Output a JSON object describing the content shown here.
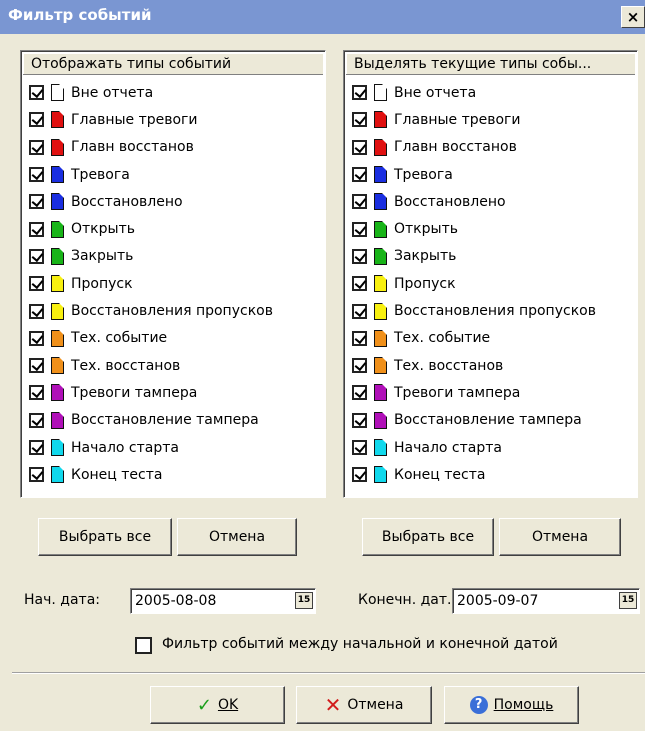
{
  "window": {
    "title": "Фильтр событий",
    "close_label": "×"
  },
  "left_list": {
    "header": "Отображать типы событий",
    "items": [
      {
        "label": "Вне отчета",
        "color": "#ffffff",
        "checked": true
      },
      {
        "label": "Главные тревоги",
        "color": "#e01010",
        "checked": true
      },
      {
        "label": "Главн восстанов",
        "color": "#e01010",
        "checked": true
      },
      {
        "label": "Тревога",
        "color": "#1a2ee0",
        "checked": true
      },
      {
        "label": "Восстановлено",
        "color": "#1a2ee0",
        "checked": true
      },
      {
        "label": "Открыть",
        "color": "#18b418",
        "checked": true
      },
      {
        "label": "Закрыть",
        "color": "#18b418",
        "checked": true
      },
      {
        "label": "Пропуск",
        "color": "#f8f010",
        "checked": true
      },
      {
        "label": "Восстановления пропусков",
        "color": "#f8f010",
        "checked": true
      },
      {
        "label": "Тех. событие",
        "color": "#f0901a",
        "checked": true
      },
      {
        "label": "Тех. восстанов",
        "color": "#f0901a",
        "checked": true
      },
      {
        "label": "Тревоги тампера",
        "color": "#b010b8",
        "checked": true
      },
      {
        "label": "Восстановление тампера",
        "color": "#b010b8",
        "checked": true
      },
      {
        "label": "Начало старта",
        "color": "#10d8ec",
        "checked": true
      },
      {
        "label": "Конец теста",
        "color": "#10d8ec",
        "checked": true
      }
    ],
    "select_all": "Выбрать все",
    "cancel": "Отмена"
  },
  "right_list": {
    "header": "Выделять текущие типы собы...",
    "items": [
      {
        "label": "Вне отчета",
        "color": "#ffffff",
        "checked": true
      },
      {
        "label": "Главные тревоги",
        "color": "#e01010",
        "checked": true
      },
      {
        "label": "Главн восстанов",
        "color": "#e01010",
        "checked": true
      },
      {
        "label": "Тревога",
        "color": "#1a2ee0",
        "checked": true
      },
      {
        "label": "Восстановлено",
        "color": "#1a2ee0",
        "checked": true
      },
      {
        "label": "Открыть",
        "color": "#18b418",
        "checked": true
      },
      {
        "label": "Закрыть",
        "color": "#18b418",
        "checked": true
      },
      {
        "label": "Пропуск",
        "color": "#f8f010",
        "checked": true
      },
      {
        "label": "Восстановления пропусков",
        "color": "#f8f010",
        "checked": true
      },
      {
        "label": "Тех. событие",
        "color": "#f0901a",
        "checked": true
      },
      {
        "label": "Тех. восстанов",
        "color": "#f0901a",
        "checked": true
      },
      {
        "label": "Тревоги тампера",
        "color": "#b010b8",
        "checked": true
      },
      {
        "label": "Восстановление тампера",
        "color": "#b010b8",
        "checked": true
      },
      {
        "label": "Начало старта",
        "color": "#10d8ec",
        "checked": true
      },
      {
        "label": "Конец теста",
        "color": "#10d8ec",
        "checked": true
      }
    ],
    "select_all": "Выбрать все",
    "cancel": "Отмена"
  },
  "dates": {
    "start_label": "Нач. дата:",
    "start_value": "2005-08-08",
    "end_label": "Конечн. дат.",
    "end_value": "2005-09-07",
    "calendar_icon_text": "15"
  },
  "filter_checkbox": {
    "label": "Фильтр событий между начальной и конечной датой",
    "checked": false
  },
  "footer": {
    "ok_label": "OK",
    "cancel_label": "Отмена",
    "help_label": "Помощь",
    "help_icon_text": "?"
  }
}
